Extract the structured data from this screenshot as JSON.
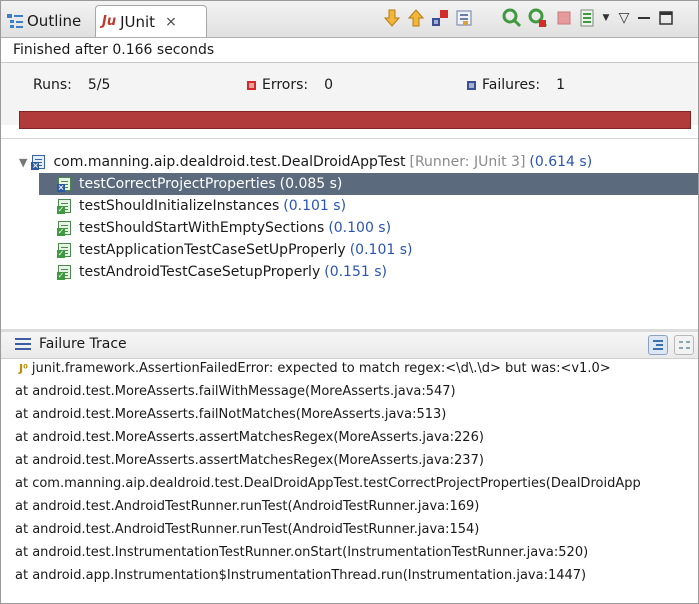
{
  "tabs": {
    "outline": {
      "label": "Outline",
      "icon": "outline-icon"
    },
    "junit": {
      "label": "JUnit",
      "icon": "junit-icon",
      "close": "⨯"
    }
  },
  "toolbar": {
    "icons": [
      "next-failure-icon",
      "previous-failure-icon",
      "show-failures-only-icon",
      "scroll-lock-icon",
      "rerun-test-icon",
      "rerun-failed-first-icon",
      "stop-icon",
      "test-run-history-icon",
      "view-menu-icon",
      "minimize-icon",
      "maximize-icon"
    ]
  },
  "status": {
    "text": "Finished after 0.166 seconds"
  },
  "counters": {
    "runs": {
      "label": "Runs:",
      "value": "5/5"
    },
    "errors": {
      "label": "Errors:",
      "value": "0",
      "color": "#d32a2a"
    },
    "failures": {
      "label": "Failures:",
      "value": "1",
      "color": "#3a4f94"
    }
  },
  "progress": {
    "fraction": 1.0,
    "color": "#b13a3a"
  },
  "tree": {
    "root": {
      "name": "com.manning.aip.dealdroid.test.DealDroidAppTest",
      "runner": "[Runner: JUnit 3]",
      "time": "(0.614 s)"
    },
    "items": [
      {
        "name": "testCorrectProjectProperties",
        "time": "(0.085 s)",
        "status": "failed",
        "selected": true
      },
      {
        "name": "testShouldInitializeInstances",
        "time": "(0.101 s)",
        "status": "passed"
      },
      {
        "name": "testShouldStartWithEmptySections",
        "time": "(0.100 s)",
        "status": "passed"
      },
      {
        "name": "testApplicationTestCaseSetUpProperly",
        "time": "(0.101 s)",
        "status": "passed"
      },
      {
        "name": "testAndroidTestCaseSetupProperly",
        "time": "(0.151 s)",
        "status": "passed"
      }
    ]
  },
  "trace": {
    "title": "Failure Trace",
    "lines": [
      "junit.framework.AssertionFailedError: expected to match regex:<\\d\\.\\d> but was:<v1.0>",
      "at android.test.MoreAsserts.failWithMessage(MoreAsserts.java:547)",
      "at android.test.MoreAsserts.failNotMatches(MoreAsserts.java:513)",
      "at android.test.MoreAsserts.assertMatchesRegex(MoreAsserts.java:226)",
      "at android.test.MoreAsserts.assertMatchesRegex(MoreAsserts.java:237)",
      "at com.manning.aip.dealdroid.test.DealDroidAppTest.testCorrectProjectProperties(DealDroidApp",
      "at android.test.AndroidTestRunner.runTest(AndroidTestRunner.java:169)",
      "at android.test.AndroidTestRunner.runTest(AndroidTestRunner.java:154)",
      "at android.test.InstrumentationTestRunner.onStart(InstrumentationTestRunner.java:520)",
      "at android.app.Instrumentation$InstrumentationThread.run(Instrumentation.java:1447)"
    ]
  }
}
